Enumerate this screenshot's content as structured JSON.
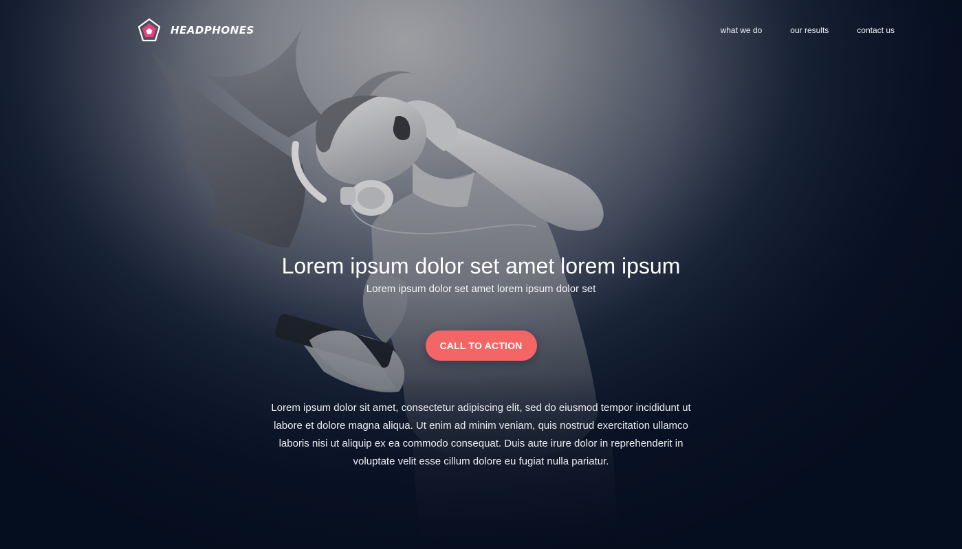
{
  "header": {
    "brand_name": "HEADPHONES",
    "logo_icon": "pentagon-logo-icon",
    "nav_items": [
      {
        "label": "what we do"
      },
      {
        "label": "our results"
      },
      {
        "label": "contact us"
      }
    ]
  },
  "hero": {
    "background_image": "woman-with-headphones-photo",
    "headline": "Lorem ipsum dolor set amet lorem ipsum",
    "subheadline": "Lorem ipsum dolor set amet lorem ipsum dolor set",
    "cta_label": "CALL TO ACTION",
    "body_text": "Lorem ipsum dolor sit amet, consectetur adipiscing elit, sed do eiusmod tempor incididunt ut labore et dolore magna aliqua. Ut enim ad minim veniam, quis nostrud exercitation ullamco laboris nisi ut aliquip ex ea commodo consequat. Duis aute irure dolor in reprehenderit in voluptate velit esse cillum dolore eu fugiat nulla pariatur."
  },
  "colors": {
    "accent": "#f46566",
    "background_dark": "#0b1426",
    "logo_pink": "#e0447c",
    "text": "#ffffff"
  }
}
